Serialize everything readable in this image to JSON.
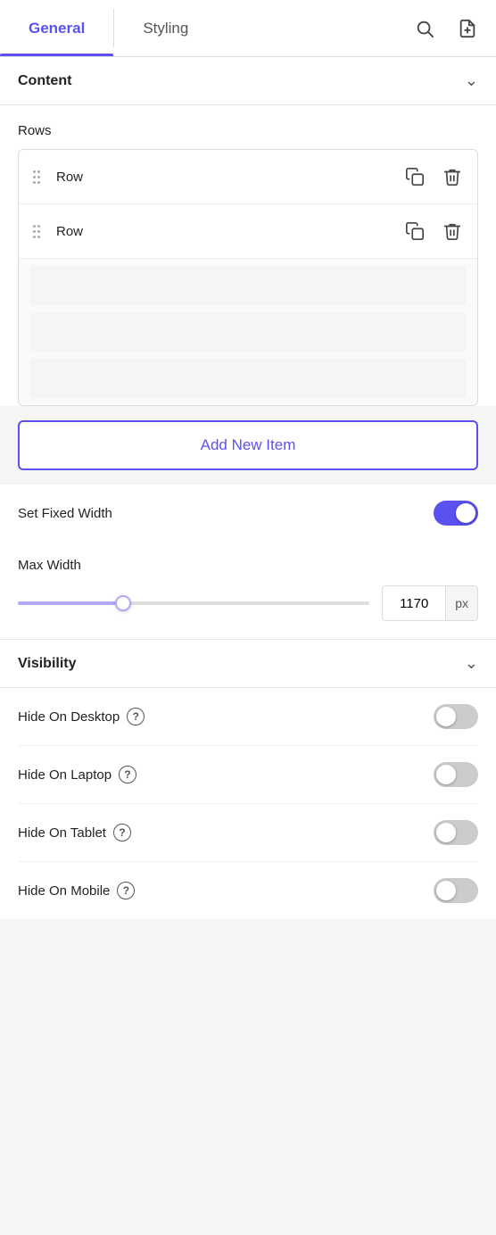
{
  "tabs": {
    "items": [
      {
        "id": "general",
        "label": "General",
        "active": true
      },
      {
        "id": "styling",
        "label": "Styling",
        "active": false
      }
    ],
    "search_icon": "search",
    "file_icon": "file"
  },
  "content_section": {
    "title": "Content",
    "rows_label": "Rows",
    "rows": [
      {
        "label": "Row",
        "id": "row-1"
      },
      {
        "label": "Row",
        "id": "row-2"
      }
    ],
    "add_new_label": "Add New Item"
  },
  "fixed_width": {
    "label": "Set Fixed Width",
    "enabled": true
  },
  "max_width": {
    "label": "Max Width",
    "value": "1170",
    "unit": "px",
    "slider_percent": 30
  },
  "visibility_section": {
    "title": "Visibility",
    "items": [
      {
        "label": "Hide On Desktop",
        "enabled": false
      },
      {
        "label": "Hide On Laptop",
        "enabled": false
      },
      {
        "label": "Hide On Tablet",
        "enabled": false
      },
      {
        "label": "Hide On Mobile",
        "enabled": false
      }
    ]
  }
}
